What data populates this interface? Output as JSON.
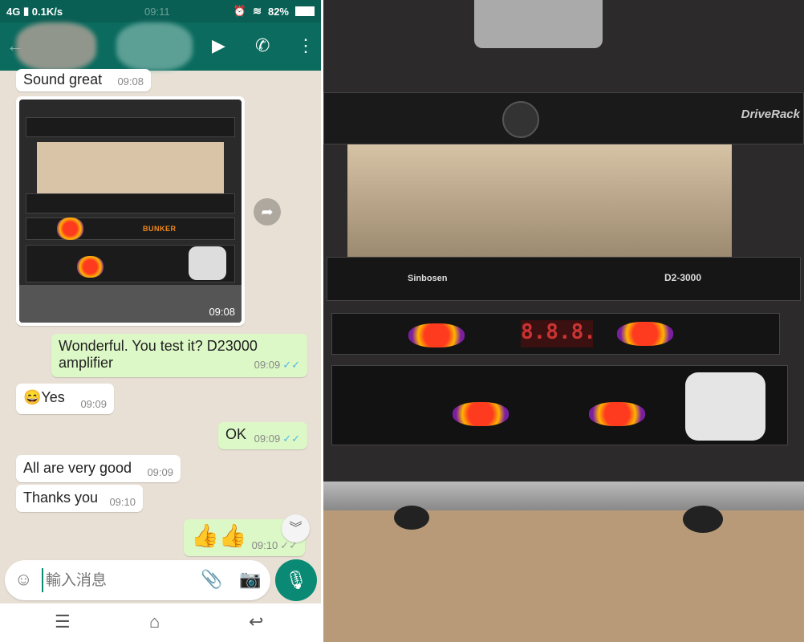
{
  "status_bar": {
    "network": "4G",
    "speed": "0.1K/s",
    "time": "09:11",
    "battery": "82%"
  },
  "header": {
    "icons": [
      "back-arrow-icon",
      "video-call-icon",
      "phone-icon",
      "more-vert-icon"
    ]
  },
  "messages": [
    {
      "dir": "in",
      "text": "Sound great",
      "time": "09:08"
    },
    {
      "dir": "in",
      "type": "image",
      "time": "09:08"
    },
    {
      "dir": "out",
      "text": "Wonderful. You test it? D23000 amplifier",
      "time": "09:09"
    },
    {
      "dir": "in",
      "text": "😄Yes",
      "time": "09:09"
    },
    {
      "dir": "out",
      "text": "OK",
      "time": "09:09"
    },
    {
      "dir": "in",
      "text": "All are very good",
      "time": "09:09"
    },
    {
      "dir": "in",
      "text": "Thanks you",
      "time": "09:10"
    },
    {
      "dir": "out",
      "text": "👍👍",
      "time": "09:10"
    }
  ],
  "input": {
    "placeholder": "輸入消息"
  },
  "photo": {
    "amp_brand": "Sinbosen",
    "amp_model": "D2-3000",
    "pdu_brand": "BUNKER",
    "pdu_display": "8.8.8.",
    "dsp_brand": "DriveRack"
  },
  "colors": {
    "header": "#0a6b5e",
    "outgoing": "#dcf8c6",
    "accent": "#0a8a74",
    "tick": "#4fb6ec"
  }
}
